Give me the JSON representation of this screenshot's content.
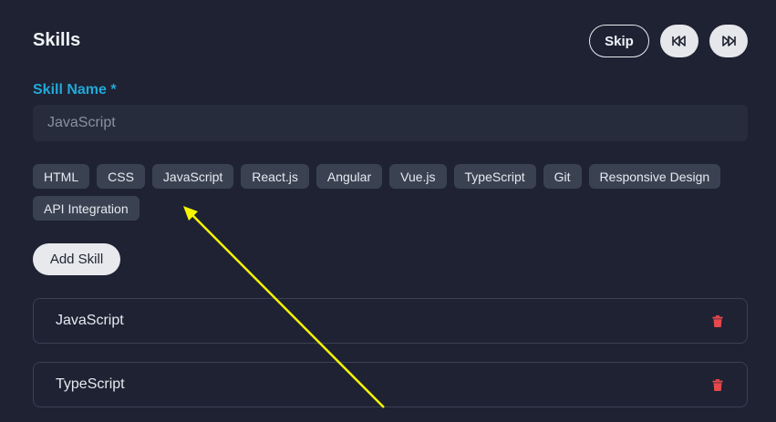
{
  "header": {
    "title": "Skills",
    "skip_label": "Skip"
  },
  "form": {
    "label": "Skill Name *",
    "placeholder": "JavaScript",
    "value": ""
  },
  "suggestions": [
    "HTML",
    "CSS",
    "JavaScript",
    "React.js",
    "Angular",
    "Vue.js",
    "TypeScript",
    "Git",
    "Responsive Design",
    "API Integration"
  ],
  "add_button_label": "Add Skill",
  "added_skills": [
    "JavaScript",
    "TypeScript"
  ],
  "colors": {
    "background": "#1e2233",
    "accent": "#22a8d8",
    "delete": "#e5484d",
    "annotation_arrow": "#f5f500"
  },
  "icons": {
    "prev": "skip-back-icon",
    "next": "skip-forward-icon",
    "delete": "trash-icon"
  }
}
